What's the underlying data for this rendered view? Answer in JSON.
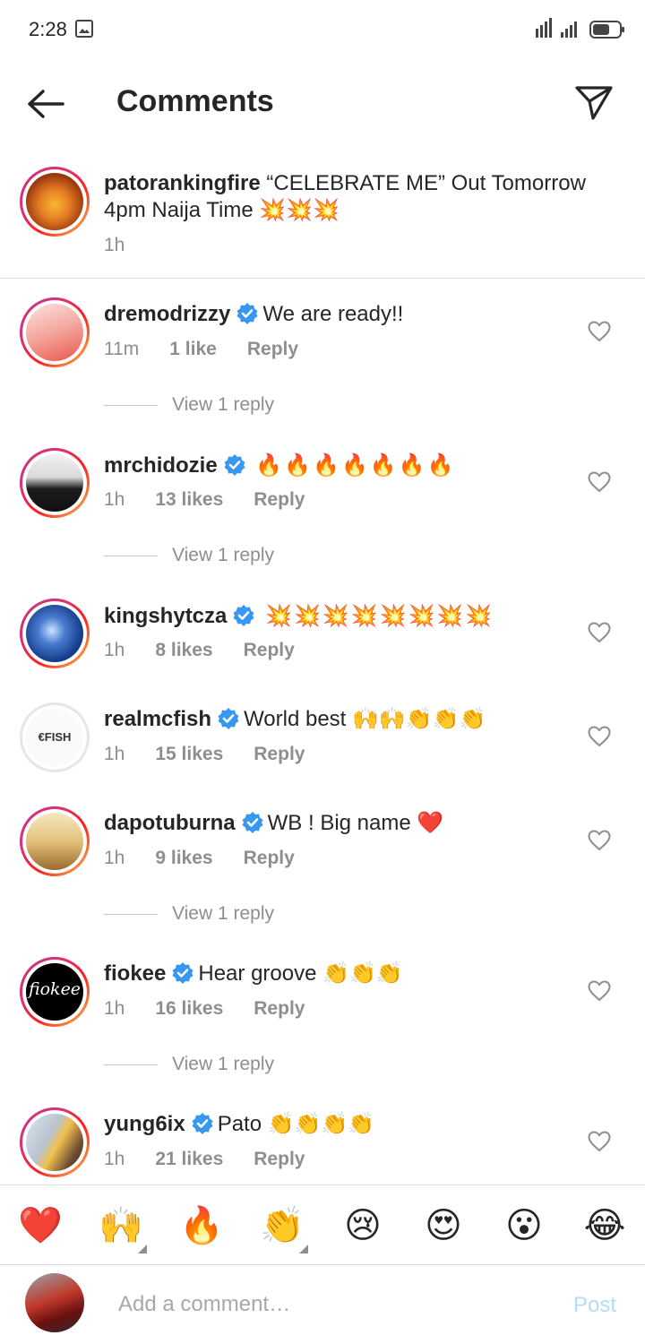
{
  "status": {
    "time": "2:28"
  },
  "header": {
    "title": "Comments"
  },
  "caption": {
    "username": "patorankingfire",
    "text": "“CELEBRATE ME” Out Tomorrow 4pm Naija Time 💥💥💥",
    "time": "1h"
  },
  "comments": [
    {
      "username": "dremodrizzy",
      "text": "We are ready!!",
      "time": "11m",
      "likes": "1 like",
      "reply": "Reply",
      "view_replies": "View 1 reply"
    },
    {
      "username": "mrchidozie",
      "text": "🔥🔥🔥🔥🔥🔥🔥",
      "time": "1h",
      "likes": "13 likes",
      "reply": "Reply",
      "view_replies": "View 1 reply"
    },
    {
      "username": "kingshytcza",
      "text": "💥💥💥💥💥💥💥💥",
      "time": "1h",
      "likes": "8 likes",
      "reply": "Reply"
    },
    {
      "username": "realmcfish",
      "text": "World best 🙌🙌👏👏👏",
      "time": "1h",
      "likes": "15 likes",
      "reply": "Reply"
    },
    {
      "username": "dapotuburna",
      "text": "WB ! Big name ❤️",
      "time": "1h",
      "likes": "9 likes",
      "reply": "Reply",
      "view_replies": "View 1 reply"
    },
    {
      "username": "fiokee",
      "text": "Hear groove 👏👏👏",
      "time": "1h",
      "likes": "16 likes",
      "reply": "Reply",
      "view_replies": "View 1 reply",
      "avatar_text": "fiokee"
    },
    {
      "username": "yung6ix",
      "text": "Pato 👏👏👏👏",
      "time": "1h",
      "likes": "21 likes",
      "reply": "Reply"
    }
  ],
  "avatar_text": {
    "realmcfish": "€FISH"
  },
  "reactions": [
    "❤️",
    "🙌",
    "🔥",
    "👏",
    "😢",
    "😍",
    "😮",
    "😂"
  ],
  "composer": {
    "placeholder": "Add a comment…",
    "post_label": "Post"
  },
  "colors": {
    "verified": "#3897f0",
    "post_disabled": "#b3dbff",
    "meta_gray": "#8e8e8e"
  }
}
